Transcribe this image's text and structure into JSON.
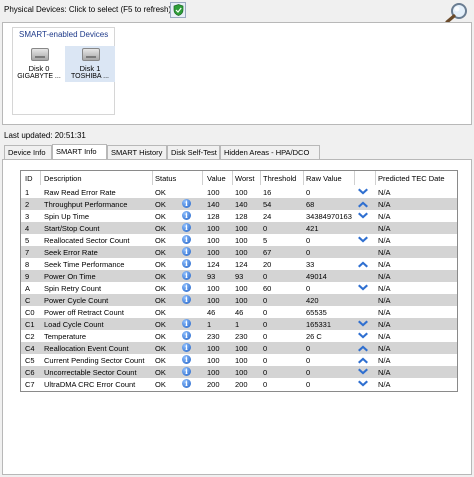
{
  "toolbar": {
    "label": "Physical Devices: Click to select (F5 to refresh)"
  },
  "devices": {
    "group_title": "SMART-enabled Devices",
    "items": [
      {
        "line1": "Disk 0",
        "line2": "GIGABYTE ..."
      },
      {
        "line1": "Disk 1",
        "line2": "TOSHIBA ..."
      }
    ]
  },
  "last_updated": "Last updated: 20:51:31",
  "tabs": [
    {
      "label": "Device Info"
    },
    {
      "label": "SMART Info"
    },
    {
      "label": "SMART History"
    },
    {
      "label": "Disk Self-Test"
    },
    {
      "label": "Hidden Areas - HPA/DCO"
    }
  ],
  "table": {
    "headers": {
      "id": "ID",
      "description": "Description",
      "status": "Status",
      "value": "Value",
      "worst": "Worst",
      "threshold": "Threshold",
      "raw": "Raw Value",
      "tec": "Predicted TEC Date"
    },
    "rows": [
      {
        "id": "1",
        "description": "Raw Read Error Rate",
        "status": "OK",
        "info": false,
        "value": "100",
        "worst": "100",
        "threshold": "16",
        "raw": "0",
        "trend": "down",
        "tec": "N/A"
      },
      {
        "id": "2",
        "description": "Throughput Performance",
        "status": "OK",
        "info": true,
        "value": "140",
        "worst": "140",
        "threshold": "54",
        "raw": "68",
        "trend": "up",
        "tec": "N/A"
      },
      {
        "id": "3",
        "description": "Spin Up Time",
        "status": "OK",
        "info": true,
        "value": "128",
        "worst": "128",
        "threshold": "24",
        "raw": "34384970163",
        "trend": "down",
        "tec": "N/A"
      },
      {
        "id": "4",
        "description": "Start/Stop Count",
        "status": "OK",
        "info": true,
        "value": "100",
        "worst": "100",
        "threshold": "0",
        "raw": "421",
        "trend": "",
        "tec": "N/A"
      },
      {
        "id": "5",
        "description": "Reallocated Sector Count",
        "status": "OK",
        "info": true,
        "value": "100",
        "worst": "100",
        "threshold": "5",
        "raw": "0",
        "trend": "down",
        "tec": "N/A"
      },
      {
        "id": "7",
        "description": "Seek Error Rate",
        "status": "OK",
        "info": true,
        "value": "100",
        "worst": "100",
        "threshold": "67",
        "raw": "0",
        "trend": "",
        "tec": "N/A"
      },
      {
        "id": "8",
        "description": "Seek Time Performance",
        "status": "OK",
        "info": true,
        "value": "124",
        "worst": "124",
        "threshold": "20",
        "raw": "33",
        "trend": "up",
        "tec": "N/A"
      },
      {
        "id": "9",
        "description": "Power On Time",
        "status": "OK",
        "info": true,
        "value": "93",
        "worst": "93",
        "threshold": "0",
        "raw": "49014",
        "trend": "",
        "tec": "N/A"
      },
      {
        "id": "A",
        "description": "Spin Retry Count",
        "status": "OK",
        "info": true,
        "value": "100",
        "worst": "100",
        "threshold": "60",
        "raw": "0",
        "trend": "down",
        "tec": "N/A"
      },
      {
        "id": "C",
        "description": "Power Cycle Count",
        "status": "OK",
        "info": true,
        "value": "100",
        "worst": "100",
        "threshold": "0",
        "raw": "420",
        "trend": "",
        "tec": "N/A"
      },
      {
        "id": "C0",
        "description": "Power off Retract Count",
        "status": "OK",
        "info": false,
        "value": "46",
        "worst": "46",
        "threshold": "0",
        "raw": "65535",
        "trend": "",
        "tec": "N/A"
      },
      {
        "id": "C1",
        "description": "Load Cycle Count",
        "status": "OK",
        "info": true,
        "value": "1",
        "worst": "1",
        "threshold": "0",
        "raw": "165331",
        "trend": "down",
        "tec": "N/A"
      },
      {
        "id": "C2",
        "description": "Temperature",
        "status": "OK",
        "info": true,
        "value": "230",
        "worst": "230",
        "threshold": "0",
        "raw": "26 C",
        "trend": "down",
        "tec": "N/A"
      },
      {
        "id": "C4",
        "description": "Reallocation Event Count",
        "status": "OK",
        "info": true,
        "value": "100",
        "worst": "100",
        "threshold": "0",
        "raw": "0",
        "trend": "up",
        "tec": "N/A"
      },
      {
        "id": "C5",
        "description": "Current Pending Sector Count",
        "status": "OK",
        "info": true,
        "value": "100",
        "worst": "100",
        "threshold": "0",
        "raw": "0",
        "trend": "up",
        "tec": "N/A"
      },
      {
        "id": "C6",
        "description": "Uncorrectable Sector Count",
        "status": "OK",
        "info": true,
        "value": "100",
        "worst": "100",
        "threshold": "0",
        "raw": "0",
        "trend": "down",
        "tec": "N/A"
      },
      {
        "id": "C7",
        "description": "UltraDMA CRC Error Count",
        "status": "OK",
        "info": true,
        "value": "200",
        "worst": "200",
        "threshold": "0",
        "raw": "0",
        "trend": "down",
        "tec": "N/A"
      }
    ]
  }
}
